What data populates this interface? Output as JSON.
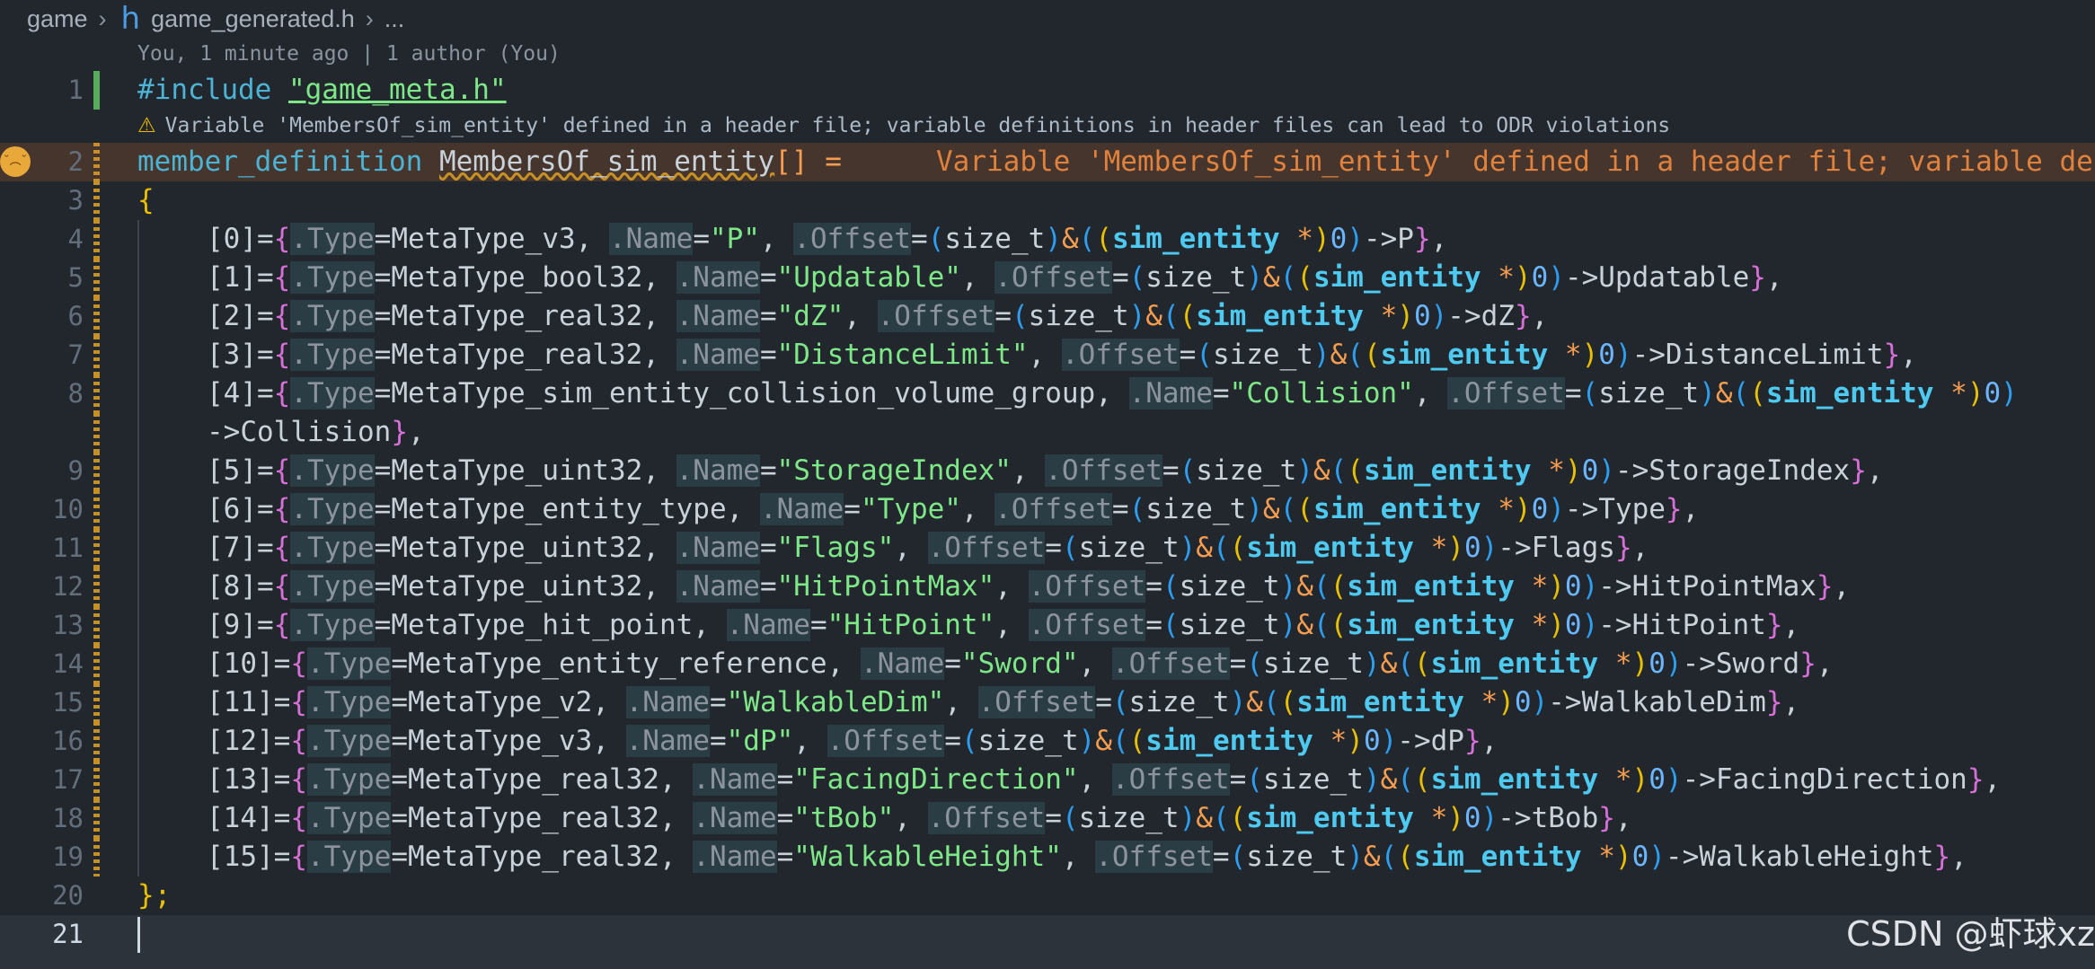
{
  "breadcrumb": {
    "folder": "game",
    "file_icon": "h",
    "file": "game_generated.h",
    "more": "..."
  },
  "codelens": "You, 1 minute ago | 1 author (You)",
  "warning_message": "Variable 'MembersOf_sim_entity' defined in a header file; variable definitions in header files can lead to ODR violations",
  "inline_error": "Variable 'MembersOf_sim_entity' defined in a header file; variable de",
  "line_numbers": [
    "1",
    "2",
    "3",
    "4",
    "5",
    "6",
    "7",
    "8",
    "9",
    "10",
    "11",
    "12",
    "13",
    "14",
    "15",
    "16",
    "17",
    "18",
    "19",
    "20",
    "21"
  ],
  "code": {
    "include_directive": "#include",
    "include_file": "\"game_meta.h\"",
    "type_name": "member_definition",
    "var_name": "MembersOf_sim_entity",
    "decl_suffix": "[] =",
    "open_brace": "{",
    "close_brace": "};",
    "cast_type": "sim_entity",
    "entries": [
      {
        "idx": "[0]",
        "type": "MetaType_v3",
        "name": "\"P\"",
        "member": "P"
      },
      {
        "idx": "[1]",
        "type": "MetaType_bool32",
        "name": "\"Updatable\"",
        "member": "Updatable"
      },
      {
        "idx": "[2]",
        "type": "MetaType_real32",
        "name": "\"dZ\"",
        "member": "dZ"
      },
      {
        "idx": "[3]",
        "type": "MetaType_real32",
        "name": "\"DistanceLimit\"",
        "member": "DistanceLimit"
      },
      {
        "idx": "[4]",
        "type": "MetaType_sim_entity_collision_volume_group",
        "name": "\"Collision\"",
        "member": "Collision"
      },
      {
        "idx": "[5]",
        "type": "MetaType_uint32",
        "name": "\"StorageIndex\"",
        "member": "StorageIndex"
      },
      {
        "idx": "[6]",
        "type": "MetaType_entity_type",
        "name": "\"Type\"",
        "member": "Type"
      },
      {
        "idx": "[7]",
        "type": "MetaType_uint32",
        "name": "\"Flags\"",
        "member": "Flags"
      },
      {
        "idx": "[8]",
        "type": "MetaType_uint32",
        "name": "\"HitPointMax\"",
        "member": "HitPointMax"
      },
      {
        "idx": "[9]",
        "type": "MetaType_hit_point",
        "name": "\"HitPoint\"",
        "member": "HitPoint"
      },
      {
        "idx": "[10]",
        "type": "MetaType_entity_reference",
        "name": "\"Sword\"",
        "member": "Sword"
      },
      {
        "idx": "[11]",
        "type": "MetaType_v2",
        "name": "\"WalkableDim\"",
        "member": "WalkableDim"
      },
      {
        "idx": "[12]",
        "type": "MetaType_v3",
        "name": "\"dP\"",
        "member": "dP"
      },
      {
        "idx": "[13]",
        "type": "MetaType_real32",
        "name": "\"FacingDirection\"",
        "member": "FacingDirection"
      },
      {
        "idx": "[14]",
        "type": "MetaType_real32",
        "name": "\"tBob\"",
        "member": "tBob"
      },
      {
        "idx": "[15]",
        "type": "MetaType_real32",
        "name": "\"WalkableHeight\"",
        "member": "WalkableHeight"
      }
    ]
  },
  "watermark": "CSDN @虾球xz",
  "colors": {
    "background": "#22272e",
    "keyword": "#4cb3d4",
    "string": "#7ee787",
    "warning_inline": "#e0823d",
    "gutter_added": "#57ab5a",
    "gutter_modified": "#c69026"
  }
}
